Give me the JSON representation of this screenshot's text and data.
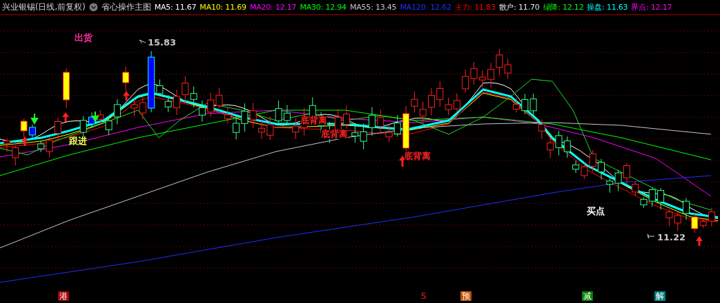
{
  "header": {
    "title": "兴业银锡(日线,前复权)",
    "indicator": "省心操作主图",
    "legend": [
      {
        "text": "MA5: 11.67",
        "color": "#ffffff"
      },
      {
        "text": "MA10: 11.69",
        "color": "#ffff00"
      },
      {
        "text": "MA20: 12.17",
        "color": "#ff00ff"
      },
      {
        "text": "MA30: 12.94",
        "color": "#00ff00"
      },
      {
        "text": "MA55: 13.45",
        "color": "#c8c8c8"
      },
      {
        "text": "MA120: 12.62",
        "color": "#2030ff"
      },
      {
        "text": "主力: 11.83",
        "color": "#ff0000"
      },
      {
        "text": "散户: 11.70",
        "color": "#e8e8e8"
      },
      {
        "text": "绿降: 12.12",
        "color": "#00ff01"
      },
      {
        "text": "操盘: 11.63",
        "color": "#00ffff"
      },
      {
        "text": "界点: 12.17",
        "color": "#ff00fe"
      }
    ]
  },
  "annotations": [
    {
      "text": "出货",
      "color": "#ff30a0"
    },
    {
      "text": "15.83",
      "color": "#c8c8c8"
    },
    {
      "text": "跟进",
      "color": "#ffff60"
    },
    {
      "text": "底背离",
      "color": "#ff2020"
    },
    {
      "text": "底背离",
      "color": "#ff2020"
    },
    {
      "text": "底背离",
      "color": "#ff2020"
    },
    {
      "text": "买点",
      "color": "#ffffff"
    },
    {
      "text": "11.22",
      "color": "#c8c8c8"
    }
  ],
  "markers": [
    {
      "text": "港",
      "color": "#a00000"
    },
    {
      "text": "S",
      "color": "#000000"
    },
    {
      "text": "预",
      "color": "#c05000"
    },
    {
      "text": "减",
      "color": "#008000"
    },
    {
      "text": "解",
      "color": "#008080"
    }
  ]
}
